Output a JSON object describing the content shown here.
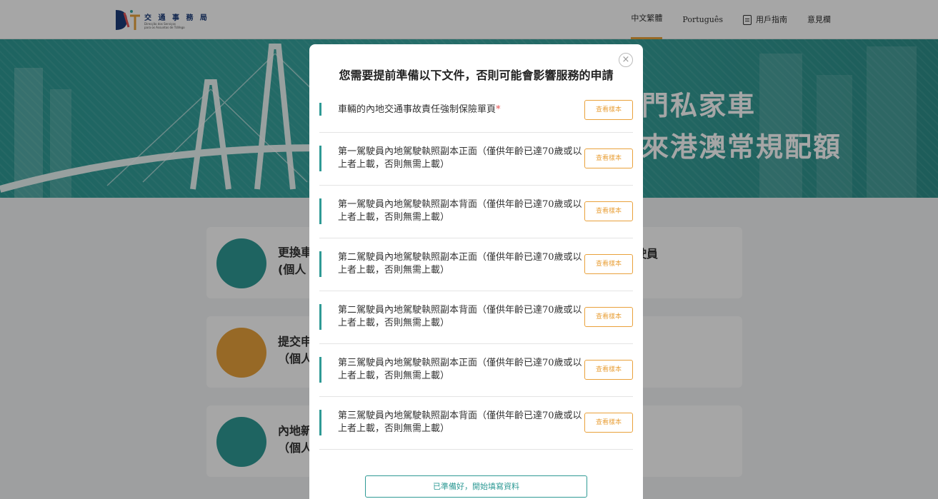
{
  "header": {
    "logo_title": "交 通 事 務 局",
    "logo_sub_1": "Direcção dos Serviços",
    "logo_sub_2": "para os Assuntos de Tráfego",
    "nav": {
      "lang_zh": "中文繁體",
      "lang_pt": "Português",
      "user_guide": "用戶指南",
      "feedback": "意見欄"
    }
  },
  "banner": {
    "title_line1": "門私家車",
    "title_line2": "來港澳常規配額"
  },
  "cards": [
    {
      "text_1": "更換車",
      "text_2": "(個人",
      "right": "駛員",
      "icon_color": "#2f9a95"
    },
    {
      "text_1": "提交申",
      "text_2": "（個人",
      "right": "",
      "icon_color": "#e9a13b"
    },
    {
      "text_1": "內地新",
      "text_2": "（個人",
      "right": "",
      "icon_color": "#2f9a95"
    }
  ],
  "modal": {
    "title": "您需要提前準備以下文件，否則可能會影響服務的申請",
    "close": "×",
    "required_mark": "*",
    "sample_label": "查看樣本",
    "documents": [
      "車輛的內地交通事故責任強制保險單頁",
      "第一駕駛員內地駕駛執照副本正面（僅供年齡已達70歲或以上者上載，否則無需上載）",
      "第一駕駛員內地駕駛執照副本背面（僅供年齡已達70歲或以上者上載，否則無需上載）",
      "第二駕駛員內地駕駛執照副本正面（僅供年齡已達70歲或以上者上載，否則無需上載）",
      "第二駕駛員內地駕駛執照副本背面（僅供年齡已達70歲或以上者上載，否則無需上載）",
      "第三駕駛員內地駕駛執照副本正面（僅供年齡已達70歲或以上者上載，否則無需上載）",
      "第三駕駛員內地駕駛執照副本背面（僅供年齡已達70歲或以上者上載，否則無需上載）"
    ],
    "ready_button": "已準備好，開始填寫資料"
  },
  "colors": {
    "accent": "#2f9a95",
    "orange": "#e9a13b",
    "required": "#e55353"
  }
}
